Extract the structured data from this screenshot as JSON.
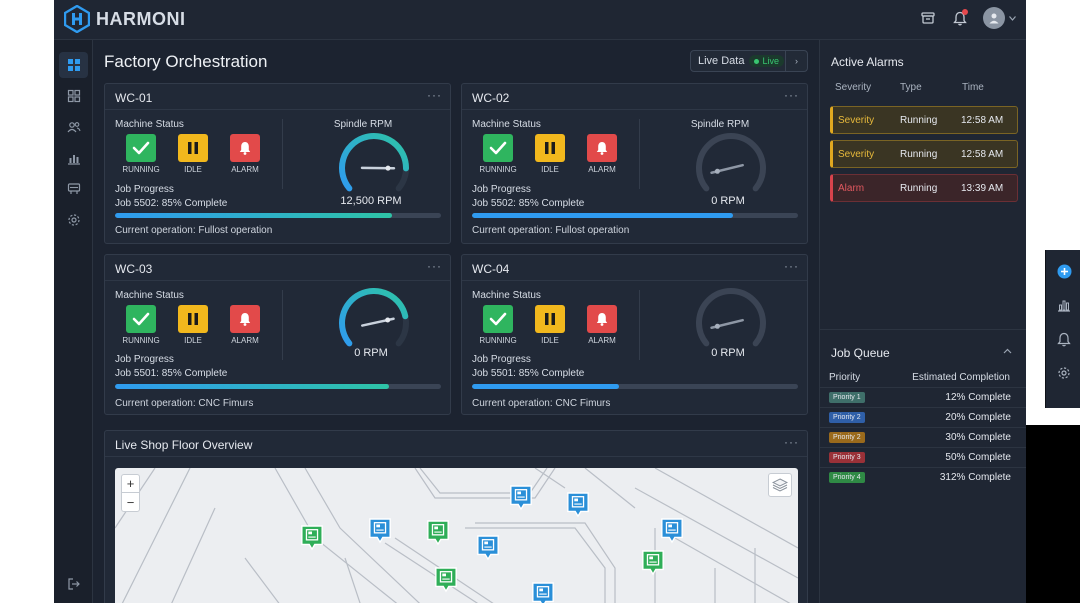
{
  "app": {
    "name": "HARMONI"
  },
  "page": {
    "title": "Factory Orchestration"
  },
  "live": {
    "label": "Live Data",
    "pill": "Live"
  },
  "status_labels": {
    "running": "RUNNING",
    "idle": "IDLE",
    "alarm": "ALARM"
  },
  "labels": {
    "machine_status": "Machine Status",
    "job_progress": "Job Progress",
    "spindle_rpm": "Spindle RPM",
    "more": "···"
  },
  "cards": [
    {
      "id": "WC-01",
      "job": "Job 5502: 85% Complete",
      "operation": "Current operation: Fullost operation",
      "rpm": "12,500 RPM",
      "progress": 0.85,
      "gauge_level": 0.85,
      "gauge_active": true
    },
    {
      "id": "WC-02",
      "job": "Job 5502: 85% Complete",
      "operation": "Current operation: Fullost operation",
      "rpm": "0 RPM",
      "progress": 0.8,
      "gauge_level": 0.1,
      "gauge_active": false
    },
    {
      "id": "WC-03",
      "job": "Job 5501: 85% Complete",
      "operation": "Current operation: CNC Fimurs",
      "rpm": "0 RPM",
      "progress": 0.84,
      "gauge_level": 0.8,
      "gauge_active": true
    },
    {
      "id": "WC-04",
      "job": "Job 5501: 85% Complete",
      "operation": "Current operation: CNC Fimurs",
      "rpm": "0 RPM",
      "progress": 0.45,
      "gauge_level": 0.1,
      "gauge_active": false
    }
  ],
  "map": {
    "title": "Live Shop Floor Overview",
    "zoom_in": "+",
    "zoom_out": "−"
  },
  "alarms": {
    "title": "Active Alarms",
    "columns": [
      "Severity",
      "Type",
      "Time"
    ],
    "rows": [
      {
        "severity": "Severity",
        "type": "Running",
        "time": "12:58 AM",
        "level": "warn"
      },
      {
        "severity": "Severity",
        "type": "Running",
        "time": "12:58 AM",
        "level": "warn"
      },
      {
        "severity": "Alarm",
        "type": "Running",
        "time": "13:39 AM",
        "level": "err"
      }
    ]
  },
  "job_queue": {
    "title": "Job Queue",
    "columns": [
      "Priority",
      "Estimated Completion"
    ],
    "rows": [
      {
        "priority": "Priority 1",
        "completion": "12% Complete",
        "color": "#3f6f6a"
      },
      {
        "priority": "Priority 2",
        "completion": "20% Complete",
        "color": "#2f5fa8"
      },
      {
        "priority": "Priority 2",
        "completion": "30% Complete",
        "color": "#9a6a1c"
      },
      {
        "priority": "Priority 3",
        "completion": "50% Complete",
        "color": "#9a3138"
      },
      {
        "priority": "Priority 4",
        "completion": "312% Complete",
        "color": "#2f8a45"
      }
    ]
  },
  "colors": {
    "accent": "#2f9bf0",
    "teal": "#2ec4a6",
    "green": "#2fb55f",
    "yellow": "#f2b81d",
    "red": "#e24a4a"
  }
}
